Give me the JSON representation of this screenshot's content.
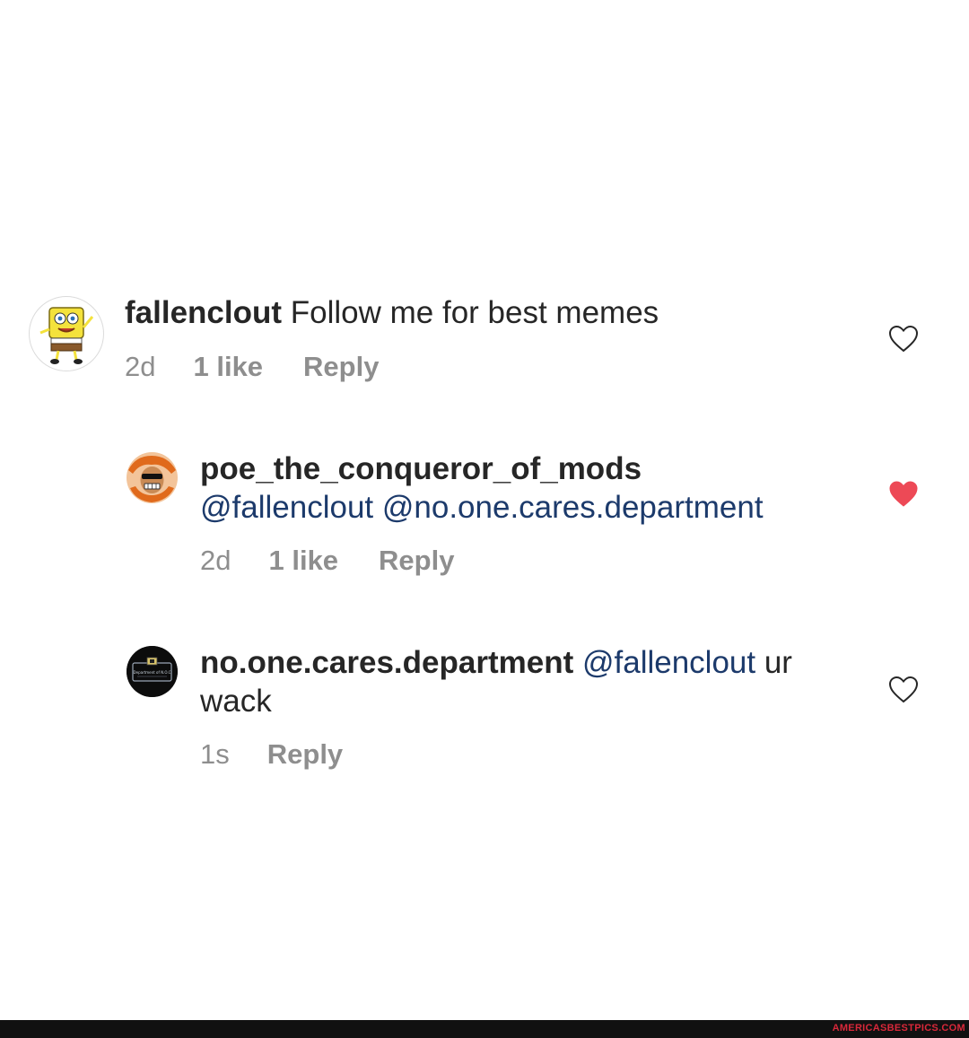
{
  "comments": [
    {
      "username": "fallenclout",
      "text": "Follow me for best memes",
      "time": "2d",
      "likes": "1 like",
      "reply_label": "Reply",
      "liked": false,
      "heart_icon": "heart-outline-icon"
    },
    {
      "username": "poe_the_conqueror_of_mods",
      "mention_1": "@fallenclout",
      "mention_2": "@no.one.cares.department",
      "time": "2d",
      "likes": "1 like",
      "reply_label": "Reply",
      "liked": true,
      "heart_icon": "heart-filled-icon",
      "heart_color": "#ed4956"
    },
    {
      "username": "no.one.cares.department",
      "mention": "@fallenclout",
      "text_part_1": "ur",
      "text_part_2": "wack",
      "time": "1s",
      "reply_label": "Reply",
      "liked": false,
      "heart_icon": "heart-outline-icon",
      "avatar_text": "Department of N.O.C"
    }
  ],
  "watermark": "AMERICASBESTPICS.COM",
  "colors": {
    "text": "#262626",
    "meta": "#8e8e8e",
    "mention": "#1c3a6b",
    "liked_heart": "#ed4956"
  }
}
